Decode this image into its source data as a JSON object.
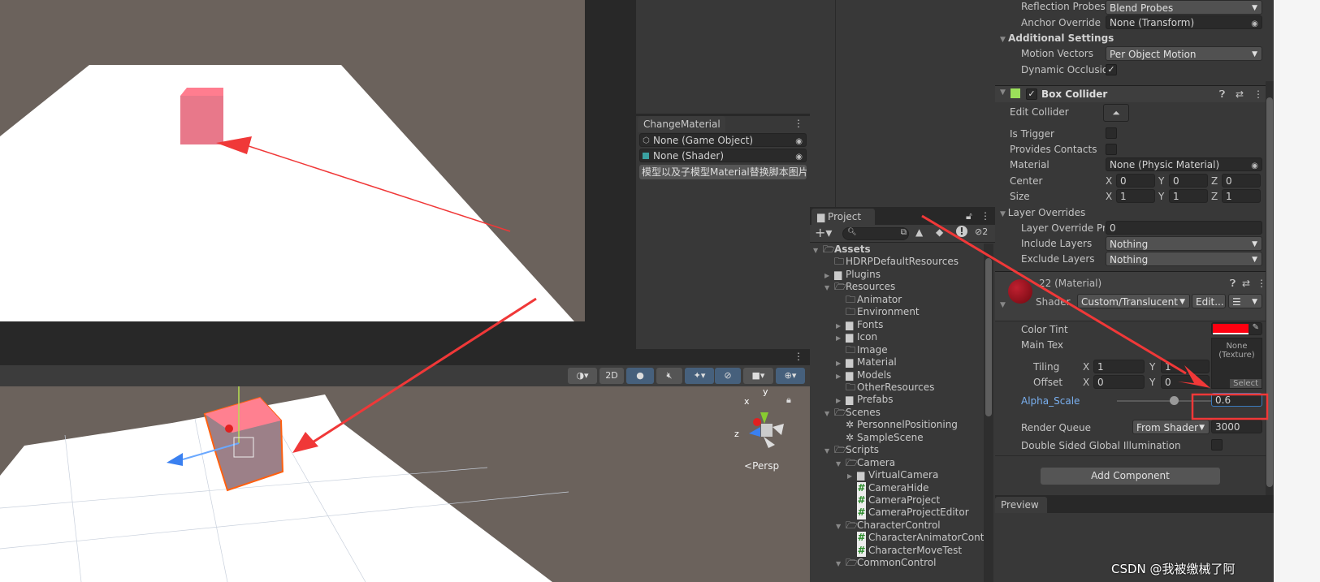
{
  "game": {
    "label": "game-view"
  },
  "change_material": {
    "tab": "ChangeMaterial",
    "fields": [
      "None (Game Object)",
      "None (Shader)"
    ],
    "button": "模型以及子模型Material替换脚本图片"
  },
  "project": {
    "tab": "Project",
    "hidden_count": "2",
    "tree": [
      {
        "label": "Assets",
        "depth": 0,
        "type": "open-folder",
        "bold": true
      },
      {
        "label": "HDRPDefaultResources",
        "depth": 1,
        "type": "empty-folder"
      },
      {
        "label": "Plugins",
        "depth": 1,
        "type": "closed-folder"
      },
      {
        "label": "Resources",
        "depth": 1,
        "type": "open-folder"
      },
      {
        "label": "Animator",
        "depth": 2,
        "type": "empty-folder"
      },
      {
        "label": "Environment",
        "depth": 2,
        "type": "empty-folder"
      },
      {
        "label": "Fonts",
        "depth": 2,
        "type": "closed-folder"
      },
      {
        "label": "Icon",
        "depth": 2,
        "type": "closed-folder"
      },
      {
        "label": "Image",
        "depth": 2,
        "type": "empty-folder"
      },
      {
        "label": "Material",
        "depth": 2,
        "type": "closed-folder"
      },
      {
        "label": "Models",
        "depth": 2,
        "type": "closed-folder"
      },
      {
        "label": "OtherResources",
        "depth": 2,
        "type": "empty-folder"
      },
      {
        "label": "Prefabs",
        "depth": 2,
        "type": "closed-folder"
      },
      {
        "label": "Scenes",
        "depth": 1,
        "type": "open-folder"
      },
      {
        "label": "PersonnelPositioning",
        "depth": 2,
        "type": "scene"
      },
      {
        "label": "SampleScene",
        "depth": 2,
        "type": "scene"
      },
      {
        "label": "Scripts",
        "depth": 1,
        "type": "open-folder"
      },
      {
        "label": "Camera",
        "depth": 2,
        "type": "open-folder"
      },
      {
        "label": "VirtualCamera",
        "depth": 3,
        "type": "closed-folder"
      },
      {
        "label": "CameraHide",
        "depth": 3,
        "type": "script"
      },
      {
        "label": "CameraProject",
        "depth": 3,
        "type": "script"
      },
      {
        "label": "CameraProjectEditor",
        "depth": 3,
        "type": "script"
      },
      {
        "label": "CharacterControl",
        "depth": 2,
        "type": "open-folder"
      },
      {
        "label": "CharacterAnimatorContor",
        "depth": 3,
        "type": "script"
      },
      {
        "label": "CharacterMoveTest",
        "depth": 3,
        "type": "script"
      },
      {
        "label": "CommonControl",
        "depth": 2,
        "type": "open-folder"
      }
    ]
  },
  "inspector": {
    "reflection_probes": {
      "label": "Reflection Probes",
      "value": "Blend Probes"
    },
    "anchor_override": {
      "label": "Anchor Override",
      "value": "None (Transform)"
    },
    "additional_settings": "Additional Settings",
    "motion_vectors": {
      "label": "Motion Vectors",
      "value": "Per Object Motion"
    },
    "dynamic_occlusion": {
      "label": "Dynamic Occlusion",
      "checked": true
    },
    "box_collider": {
      "title": "Box Collider",
      "enabled": true,
      "edit_collider": "Edit Collider",
      "is_trigger": "Is Trigger",
      "provides_contacts": "Provides Contacts",
      "material": {
        "label": "Material",
        "value": "None (Physic Material)"
      },
      "center": {
        "label": "Center",
        "x": "0",
        "y": "0",
        "z": "0"
      },
      "size": {
        "label": "Size",
        "x": "1",
        "y": "1",
        "z": "1"
      },
      "layer_overrides": "Layer Overrides",
      "layer_override_priority": {
        "label": "Layer Override Priority",
        "value": "0"
      },
      "include_layers": {
        "label": "Include Layers",
        "value": "Nothing"
      },
      "exclude_layers": {
        "label": "Exclude Layers",
        "value": "Nothing"
      }
    },
    "material": {
      "title": "22 (Material)",
      "shader_label": "Shader",
      "shader": "Custom/Translucent",
      "edit": "Edit...",
      "color_tint": {
        "label": "Color Tint",
        "color": "#ff0010"
      },
      "main_tex": {
        "label": "Main Tex",
        "value": "None\n(Texture)",
        "select": "Select"
      },
      "tiling": {
        "label": "Tiling",
        "x": "1",
        "y": "1"
      },
      "offset": {
        "label": "Offset",
        "x": "0",
        "y": "0"
      },
      "alpha_scale": {
        "label": "Alpha_Scale",
        "value": "0.6",
        "fraction": 0.6
      },
      "render_queue": {
        "label": "Render Queue",
        "mode": "From Shader",
        "value": "3000"
      },
      "double_sided_gi": {
        "label": "Double Sided Global Illumination",
        "checked": false
      }
    },
    "add_component": "Add Component",
    "preview": "Preview",
    "axis": {
      "x": "X",
      "y": "Y",
      "z": "Z"
    }
  },
  "scene": {
    "toolbar": {
      "two_d": "2D"
    },
    "gizmo": {
      "x": "x",
      "y": "y",
      "z": "z",
      "persp": "Persp"
    }
  },
  "watermark": "CSDN @我被缴械了阿",
  "colors": {
    "accent": "#46607c",
    "annotation": "#f03838",
    "highlight_label": "#7ab0f0"
  }
}
